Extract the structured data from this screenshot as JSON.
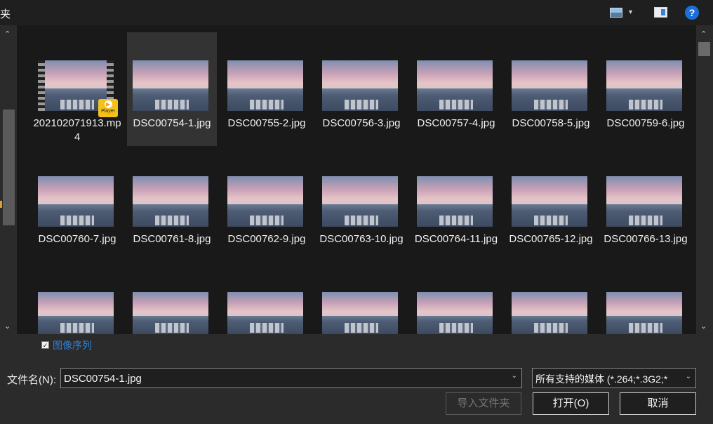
{
  "header": {
    "title_fragment": "夹",
    "view_icon": "thumbnail-view-icon",
    "view_dropdown": "▾",
    "pane_icon": "preview-pane-icon",
    "help": "?"
  },
  "left_scroll": {
    "up": "⌃",
    "down": "⌄"
  },
  "right_scroll": {
    "up": "⌃",
    "down": "⌄"
  },
  "files": [
    {
      "name": "202102071913.mp4",
      "type": "video",
      "badge": "Player",
      "badge_icon": "▶"
    },
    {
      "name": "DSC00754-1.jpg",
      "type": "image",
      "selected": true
    },
    {
      "name": "DSC00755-2.jpg",
      "type": "image"
    },
    {
      "name": "DSC00756-3.jpg",
      "type": "image"
    },
    {
      "name": "DSC00757-4.jpg",
      "type": "image"
    },
    {
      "name": "DSC00758-5.jpg",
      "type": "image"
    },
    {
      "name": "DSC00759-6.jpg",
      "type": "image"
    },
    {
      "name": "DSC00760-7.jpg",
      "type": "image"
    },
    {
      "name": "DSC00761-8.jpg",
      "type": "image"
    },
    {
      "name": "DSC00762-9.jpg",
      "type": "image"
    },
    {
      "name": "DSC00763-10.jpg",
      "type": "image"
    },
    {
      "name": "DSC00764-11.jpg",
      "type": "image"
    },
    {
      "name": "DSC00765-12.jpg",
      "type": "image"
    },
    {
      "name": "DSC00766-13.jpg",
      "type": "image"
    },
    {
      "name": "",
      "type": "image"
    },
    {
      "name": "",
      "type": "image"
    },
    {
      "name": "",
      "type": "image"
    },
    {
      "name": "",
      "type": "image"
    },
    {
      "name": "",
      "type": "image"
    },
    {
      "name": "",
      "type": "image"
    },
    {
      "name": "",
      "type": "image"
    }
  ],
  "bottom": {
    "sequence_label": "图像序列",
    "sequence_checked": "✓",
    "filename_label": "文件名(N):",
    "filename_value": "DSC00754-1.jpg",
    "filename_dropdown": "⌄",
    "filter_value": "所有支持的媒体 (*.264;*.3G2;*",
    "filter_dropdown": "⌄",
    "import_folder": "导入文件夹",
    "open": "打开(O)",
    "cancel": "取消"
  }
}
